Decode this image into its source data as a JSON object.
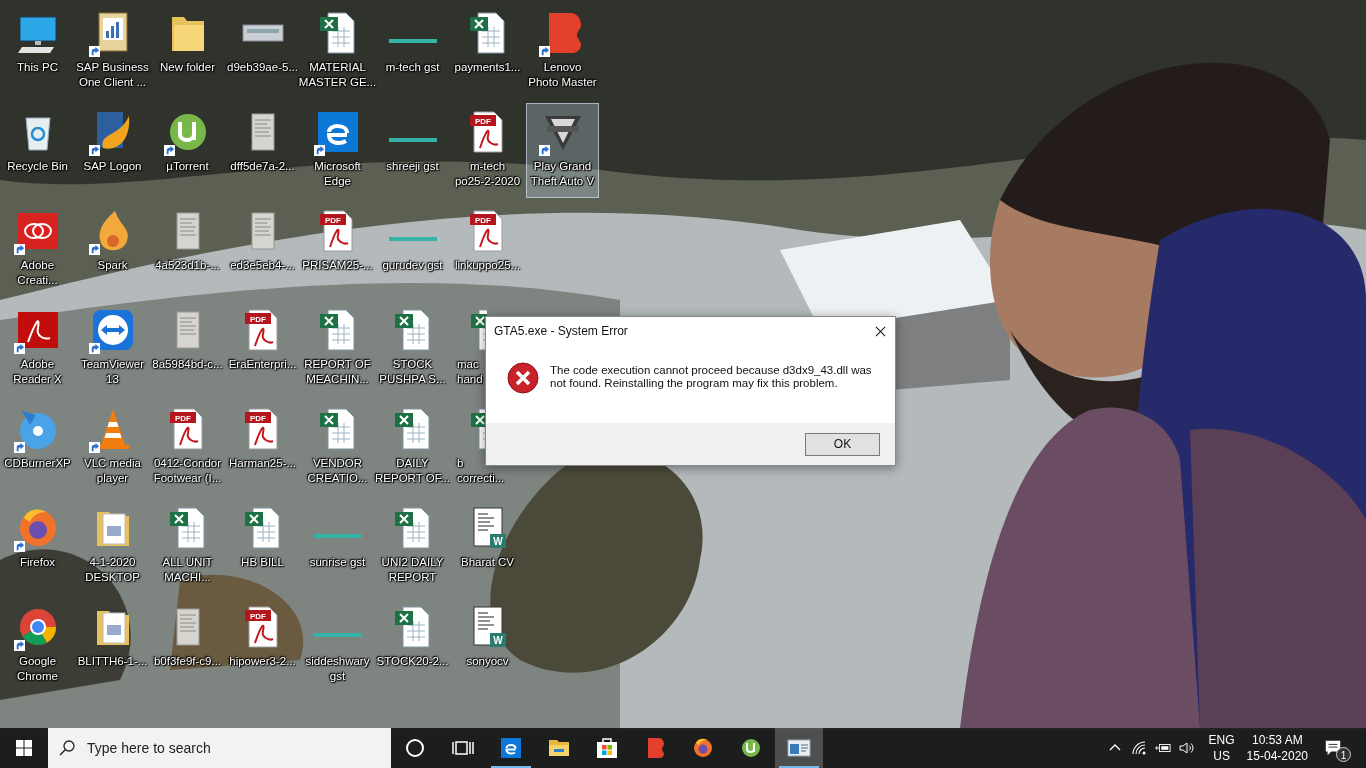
{
  "desktop": {
    "icons": [
      {
        "kind": "pc",
        "label": [
          "This PC"
        ],
        "shortcut": false,
        "selected": false
      },
      {
        "kind": "recycle",
        "label": [
          "Recycle Bin"
        ],
        "shortcut": false,
        "selected": false
      },
      {
        "kind": "adobe-cc",
        "label": [
          "Adobe",
          "Creati..."
        ],
        "shortcut": true,
        "selected": false
      },
      {
        "kind": "reader",
        "label": [
          "Adobe",
          "Reader X"
        ],
        "shortcut": true,
        "selected": false
      },
      {
        "kind": "disc",
        "label": [
          "CDBurnerXP"
        ],
        "shortcut": true,
        "selected": false
      },
      {
        "kind": "firefox",
        "label": [
          "Firefox"
        ],
        "shortcut": true,
        "selected": false
      },
      {
        "kind": "chrome",
        "label": [
          "Google",
          "Chrome"
        ],
        "shortcut": true,
        "selected": false
      },
      {
        "kind": "sap",
        "label": [
          "SAP Business",
          "One Client ..."
        ],
        "shortcut": true,
        "selected": false
      },
      {
        "kind": "sap-logon",
        "label": [
          "SAP Logon"
        ],
        "shortcut": true,
        "selected": false
      },
      {
        "kind": "spark",
        "label": [
          "Spark"
        ],
        "shortcut": true,
        "selected": false
      },
      {
        "kind": "teamviewer",
        "label": [
          "TeamViewer",
          "13"
        ],
        "shortcut": true,
        "selected": false
      },
      {
        "kind": "vlc",
        "label": [
          "VLC media",
          "player"
        ],
        "shortcut": true,
        "selected": false
      },
      {
        "kind": "folder-docs",
        "label": [
          "4-1-2020",
          "DESKTOP"
        ],
        "shortcut": false,
        "selected": false
      },
      {
        "kind": "folder-docs",
        "label": [
          "BLITTH6-1-..."
        ],
        "shortcut": false,
        "selected": false
      },
      {
        "kind": "folder",
        "label": [
          "New folder"
        ],
        "shortcut": false,
        "selected": false
      },
      {
        "kind": "utorrent",
        "label": [
          "µTorrent"
        ],
        "shortcut": true,
        "selected": false
      },
      {
        "kind": "scan",
        "label": [
          "4a523d1b-..."
        ],
        "shortcut": false,
        "selected": false
      },
      {
        "kind": "scan",
        "label": [
          "8a5984bd-c..."
        ],
        "shortcut": false,
        "selected": false
      },
      {
        "kind": "pdf",
        "badge": "PDF",
        "label": [
          "0412-Condor",
          "Footwear (I..."
        ],
        "shortcut": false,
        "selected": false
      },
      {
        "kind": "excel",
        "label": [
          "ALL UNIT",
          "MACHI..."
        ],
        "shortcut": false,
        "selected": false
      },
      {
        "kind": "scan",
        "label": [
          "b0f3fe9f-c9..."
        ],
        "shortcut": false,
        "selected": false
      },
      {
        "label": [
          "d9eb39ae-5..."
        ],
        "shortcut": false,
        "selected": false
      },
      {
        "kind": "scan",
        "label": [
          "dff5de7a-2..."
        ],
        "shortcut": false,
        "selected": false
      },
      {
        "kind": "scan",
        "label": [
          "ed3e5eb4-..."
        ],
        "shortcut": false,
        "selected": false
      },
      {
        "kind": "pdf",
        "badge": "PDF",
        "label": [
          "EraEnterpri..."
        ],
        "shortcut": false,
        "selected": false
      },
      {
        "kind": "pdf",
        "badge": "PDF",
        "label": [
          "Harman25-..."
        ],
        "shortcut": false,
        "selected": false
      },
      {
        "kind": "excel",
        "label": [
          "HB BILL"
        ],
        "shortcut": false,
        "selected": false
      },
      {
        "kind": "pdf",
        "badge": "PDF",
        "label": [
          "hipower3-2..."
        ],
        "shortcut": false,
        "selected": false
      },
      {
        "kind": "excel",
        "label": [
          "MATERIAL",
          "MASTER GE..."
        ],
        "shortcut": false,
        "selected": false
      },
      {
        "kind": "edge",
        "label": [
          "Microsoft",
          "Edge"
        ],
        "shortcut": true,
        "selected": false
      },
      {
        "kind": "pdf",
        "badge": "PDF",
        "label": [
          "PRISAM25-..."
        ],
        "shortcut": false,
        "selected": false
      },
      {
        "kind": "excel",
        "label": [
          "REPORT OF",
          "MEACHIN..."
        ],
        "shortcut": false,
        "selected": false
      },
      {
        "kind": "excel",
        "label": [
          "VENDOR",
          "CREATIO..."
        ],
        "shortcut": false,
        "selected": false
      },
      {
        "kind": "strip",
        "label": [
          "sunrise gst"
        ],
        "shortcut": false,
        "selected": false
      },
      {
        "kind": "strip",
        "label": [
          "siddeshwary",
          "gst"
        ],
        "shortcut": false,
        "selected": false
      },
      {
        "kind": "strip",
        "label": [
          "m-tech gst"
        ],
        "shortcut": false,
        "selected": false
      },
      {
        "kind": "strip",
        "label": [
          "shreeji gst"
        ],
        "shortcut": false,
        "selected": false
      },
      {
        "kind": "strip",
        "label": [
          "gurudev gst"
        ],
        "shortcut": false,
        "selected": false
      },
      {
        "kind": "excel",
        "label": [
          "STOCK",
          "PUSHPA S..."
        ],
        "shortcut": false,
        "selected": false
      },
      {
        "kind": "excel",
        "label": [
          "DAILY",
          "REPORT OF..."
        ],
        "shortcut": false,
        "selected": false
      },
      {
        "kind": "excel",
        "label": [
          "UNI2 DAILY",
          "REPORT"
        ],
        "shortcut": false,
        "selected": false
      },
      {
        "kind": "excel",
        "label": [
          "STOCK20-2..."
        ],
        "shortcut": false,
        "selected": false
      },
      {
        "kind": "excel",
        "label": [
          "payments1..."
        ],
        "shortcut": false,
        "selected": false
      },
      {
        "kind": "pdf",
        "badge": "PDF",
        "label": [
          "m-tech",
          "po25-2-2020"
        ],
        "shortcut": false,
        "selected": false
      },
      {
        "kind": "pdf",
        "badge": "PDF",
        "label": [
          "linkuppo25..."
        ],
        "shortcut": false,
        "selected": false
      },
      {
        "kind": "excel",
        "label": [
          "mac",
          "hand"
        ],
        "shortcut": false,
        "selected": false,
        "covered": true
      },
      {
        "kind": "excel",
        "label": [
          "b",
          "correcti..."
        ],
        "shortcut": false,
        "selected": false,
        "covered": true
      },
      {
        "kind": "word",
        "badge": "W",
        "label": [
          "Bharat CV"
        ],
        "shortcut": false,
        "selected": false
      },
      {
        "kind": "word",
        "badge": "W",
        "label": [
          "sonyocv"
        ],
        "shortcut": false,
        "selected": false
      },
      {
        "kind": "lenovo",
        "label": [
          "Lenovo",
          "Photo Master"
        ],
        "shortcut": true,
        "selected": false
      },
      {
        "kind": "gta",
        "label": [
          "Play Grand",
          "Theft Auto V"
        ],
        "shortcut": true,
        "selected": true
      }
    ]
  },
  "dialog": {
    "title": "GTA5.exe - System Error",
    "message": "The code execution cannot proceed because d3dx9_43.dll was not found. Reinstalling the program may fix this problem.",
    "button": "OK"
  },
  "taskbar": {
    "search": {
      "placeholder": "Type here to search"
    },
    "apps": [
      {
        "kind": "cortana",
        "running": false,
        "active": false
      },
      {
        "kind": "taskview",
        "running": false,
        "active": false
      },
      {
        "kind": "edge",
        "running": true,
        "active": false
      },
      {
        "kind": "explorer",
        "running": false,
        "active": false
      },
      {
        "kind": "store",
        "running": false,
        "active": false
      },
      {
        "kind": "lenovo",
        "running": false,
        "active": false
      },
      {
        "kind": "firefox",
        "running": false,
        "active": false
      },
      {
        "kind": "utorrent",
        "running": false,
        "active": false
      },
      {
        "kind": "window",
        "running": true,
        "active": true
      }
    ],
    "tray": {
      "language": "ENG",
      "region": "US",
      "time": "10:53 AM",
      "date": "15-04-2020",
      "notifications": "1"
    }
  }
}
